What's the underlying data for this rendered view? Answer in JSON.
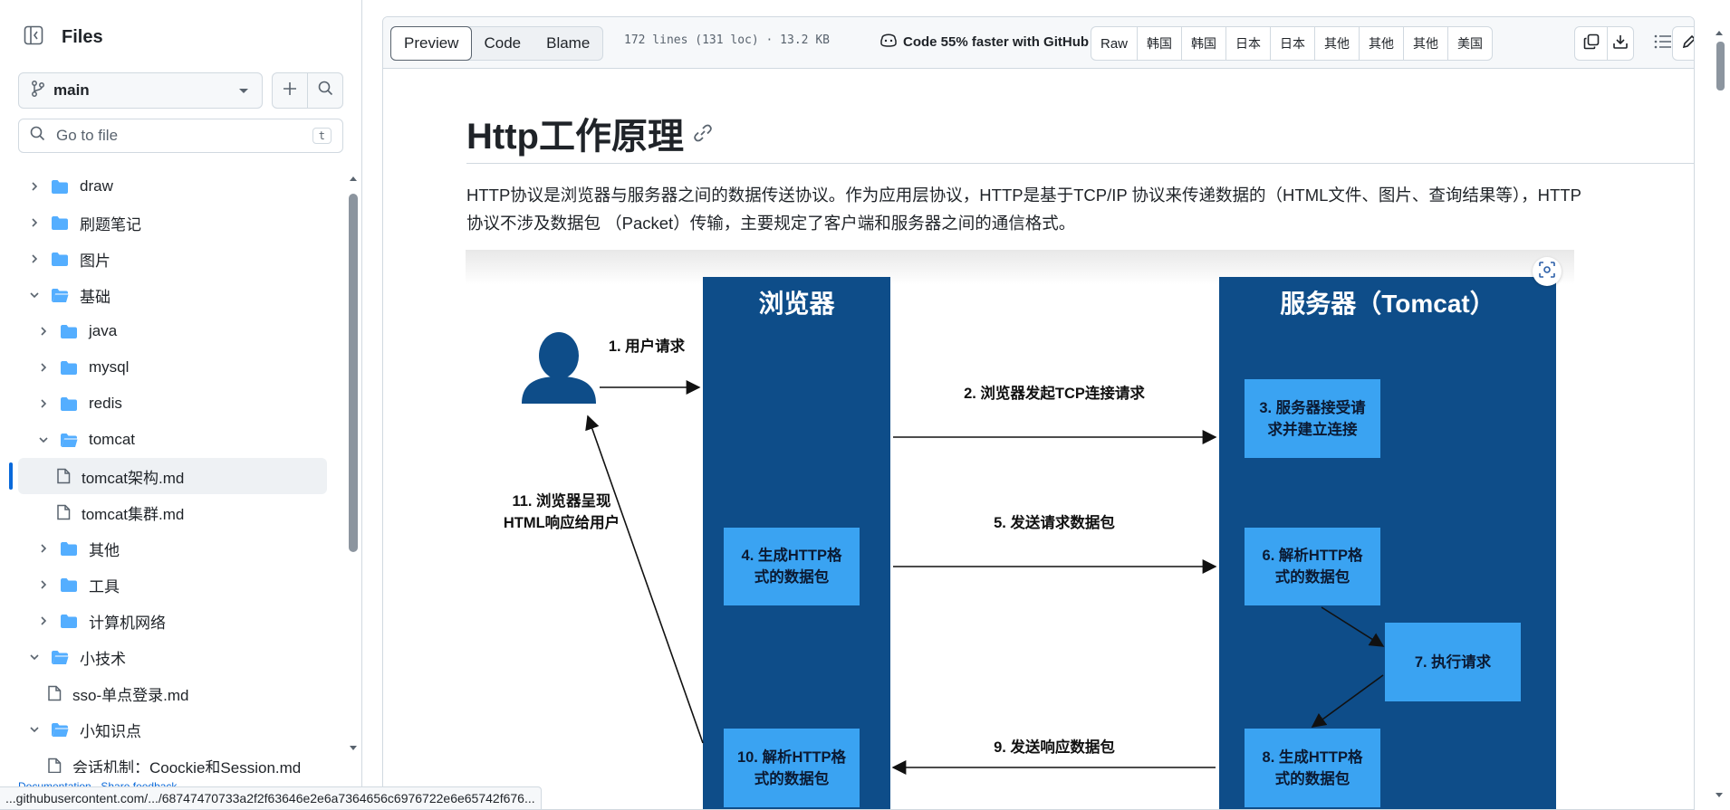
{
  "sidebar": {
    "title": "Files",
    "branch": "main",
    "goto_placeholder": "Go to file",
    "goto_shortcut": "t",
    "tree": [
      {
        "label": "draw",
        "type": "folder",
        "level": 0,
        "expanded": false
      },
      {
        "label": "刷题笔记",
        "type": "folder",
        "level": 0,
        "expanded": false
      },
      {
        "label": "图片",
        "type": "folder",
        "level": 0,
        "expanded": false
      },
      {
        "label": "基础",
        "type": "folder",
        "level": 0,
        "expanded": true
      },
      {
        "label": "java",
        "type": "folder",
        "level": 1,
        "expanded": false
      },
      {
        "label": "mysql",
        "type": "folder",
        "level": 1,
        "expanded": false
      },
      {
        "label": "redis",
        "type": "folder",
        "level": 1,
        "expanded": false
      },
      {
        "label": "tomcat",
        "type": "folder",
        "level": 1,
        "expanded": true
      },
      {
        "label": "tomcat架构.md",
        "type": "file",
        "level": 2,
        "selected": true
      },
      {
        "label": "tomcat集群.md",
        "type": "file",
        "level": 2
      },
      {
        "label": "其他",
        "type": "folder",
        "level": 1,
        "expanded": false
      },
      {
        "label": "工具",
        "type": "folder",
        "level": 1,
        "expanded": false
      },
      {
        "label": "计算机网络",
        "type": "folder",
        "level": 1,
        "expanded": false
      },
      {
        "label": "小技术",
        "type": "folder",
        "level": 0,
        "expanded": true
      },
      {
        "label": "sso-单点登录.md",
        "type": "file",
        "level": 1
      },
      {
        "label": "小知识点",
        "type": "folder",
        "level": 0,
        "expanded": true
      },
      {
        "label": "会话机制：Coockie和Session.md",
        "type": "file",
        "level": 1
      }
    ]
  },
  "toolbar": {
    "tabs": [
      "Preview",
      "Code",
      "Blame"
    ],
    "active_tab": "Preview",
    "meta": "172 lines (131 loc) · 13.2 KB",
    "copilot_text": "Code 55% faster with GitHub Copilot",
    "raw_buttons": [
      "Raw",
      "韩国",
      "韩国",
      "日本",
      "日本",
      "其他",
      "其他",
      "其他",
      "美国"
    ]
  },
  "content": {
    "heading": "Http工作原理",
    "paragraph": "HTTP协议是浏览器与服务器之间的数据传送协议。作为应用层协议，HTTP是基于TCP/IP 协议来传递数据的（HTML文件、图片、查询结果等），HTTP协议不涉及数据包 （Packet）传输，主要规定了客户端和服务器之间的通信格式。"
  },
  "diagram": {
    "browser_title": "浏览器",
    "server_title": "服务器（Tomcat）",
    "step1": "1. 用户请求",
    "step2": "2. 浏览器发起TCP连接请求",
    "step3": "3. 服务器接受请求并建立连接",
    "step4": "4. 生成HTTP格式的数据包",
    "step5": "5. 发送请求数据包",
    "step6": "6. 解析HTTP格式的数据包",
    "step7": "7. 执行请求",
    "step8": "8. 生成HTTP格式的数据包",
    "step9": "9. 发送响应数据包",
    "step10": "10. 解析HTTP格式的数据包",
    "step11": "11. 浏览器呈现HTML响应给用户",
    "colors": {
      "lane": "#0e4d89",
      "box": "#3aa3f2",
      "arrow": "#111111"
    }
  },
  "footer": {
    "links": "Documentation · Share feedback"
  },
  "statusbar": {
    "url": "...githubusercontent.com/.../68747470733a2f2f63646e2e6a7364656c6976722e6e65742f676..."
  }
}
